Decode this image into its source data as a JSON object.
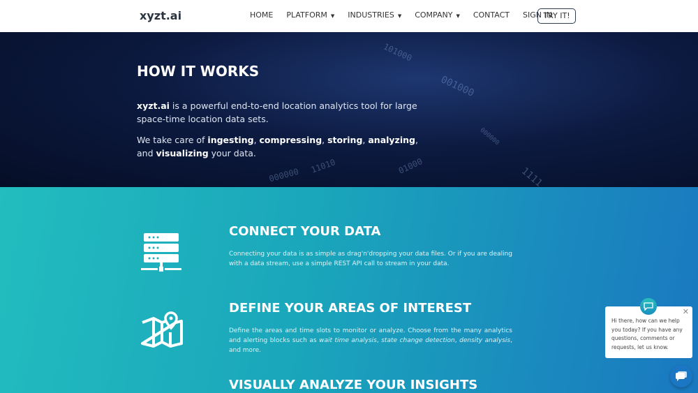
{
  "nav": {
    "logo": "xyzt.ai",
    "items": [
      {
        "label": "HOME",
        "dropdown": false
      },
      {
        "label": "PLATFORM",
        "dropdown": true
      },
      {
        "label": "INDUSTRIES",
        "dropdown": true
      },
      {
        "label": "COMPANY",
        "dropdown": true
      },
      {
        "label": "CONTACT",
        "dropdown": false
      },
      {
        "label": "SIGN IN",
        "dropdown": false
      }
    ],
    "cta": "TRY IT!"
  },
  "hero": {
    "title": "HOW IT WORKS",
    "p1_bold": "xyzt.ai",
    "p1_rest": " is a powerful end-to-end location analytics tool for large space-time location data sets.",
    "p2": [
      "We take care of ",
      "ingesting",
      ", ",
      "compressing",
      ", ",
      "storing",
      ", ",
      "analyzing",
      ", and ",
      "visualizing",
      " your data."
    ]
  },
  "sections": [
    {
      "title": "CONNECT YOUR DATA",
      "text": "Connecting your data is as simple as drag'n'dropping your data files. Or if you are dealing with a data stream, use a simple REST API call to stream in your data.",
      "icon": "server-icon"
    },
    {
      "title": "DEFINE YOUR AREAS OF INTEREST",
      "text_parts": [
        "Define the areas and time slots to monitor or analyze. Choose from the many analytics and alerting blocks such as ",
        "wait time analysis",
        ", ",
        "state change detection",
        ", ",
        "density analysis",
        ", and more."
      ],
      "icon": "map-pin-icon"
    },
    {
      "title": "VISUALLY ANALYZE YOUR INSIGHTS"
    }
  ],
  "chat": {
    "message": "Hi there, how can we help you today? If you have any questions, comments or requests, let us know."
  },
  "colors": {
    "gradient_start": "#22bdbf",
    "gradient_end": "#1a78c0",
    "hero_bg": "#0c1a40"
  }
}
